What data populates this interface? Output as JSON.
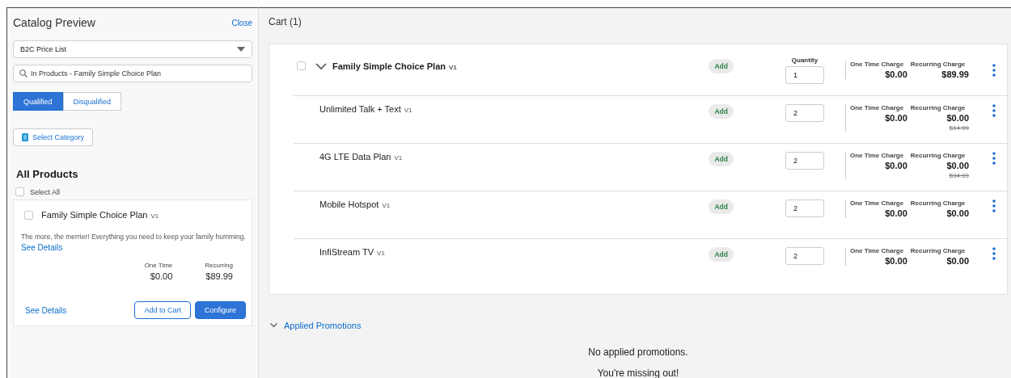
{
  "sidebar": {
    "title": "Catalog Preview",
    "close": "Close",
    "price_list": "B2C Price List",
    "search": {
      "value": "In Products - Family Simple Choice Plan"
    },
    "tabs": [
      {
        "label": "Qualified",
        "selected": true
      },
      {
        "label": "Disqualified",
        "selected": false
      }
    ],
    "category_button": "Select Category",
    "heading": "All Products",
    "select_all": {
      "label": "Select All",
      "checked": false
    },
    "products": [
      {
        "name": "Family Simple Choice Plan",
        "version": "V1",
        "checked": false,
        "description": "The more, the merrier! Everything you need to keep your family humming.",
        "details_link": "See Details",
        "one_time_label": "One Time",
        "one_time": "$0.00",
        "recurring_label": "Recurring",
        "recurring": "$89.99",
        "footer_link": "See Details",
        "buttons": [
          "Add to Cart",
          "Configure"
        ]
      }
    ]
  },
  "cart": {
    "title": "Cart (1)",
    "items": [
      {
        "kind": "parent",
        "name": "Family Simple Choice Plan",
        "version": "V1",
        "checked": false,
        "expanded": true,
        "badge": "Add",
        "quantity_label": "Quantity",
        "quantity": "1",
        "one_time_label": "One Time Charge",
        "recurring_label": "Recurring Charge",
        "one_time": "$0.00",
        "recurring": "$89.99"
      },
      {
        "kind": "child",
        "name": "Unlimited Talk + Text",
        "version": "V1",
        "badge": "Add",
        "quantity": "2",
        "one_time_label": "One Time Charge",
        "recurring_label": "Recurring Charge",
        "one_time": "$0.00",
        "recurring": "$0.00",
        "original": "$14.99"
      },
      {
        "kind": "child",
        "name": "4G LTE Data Plan",
        "version": "V1",
        "badge": "Add",
        "quantity": "2",
        "one_time_label": "One Time Charge",
        "recurring_label": "Recurring Charge",
        "one_time": "$0.00",
        "recurring": "$0.00",
        "original": "$34.99"
      },
      {
        "kind": "child",
        "name": "Mobile Hotspot",
        "version": "V1",
        "badge": "Add",
        "quantity": "2",
        "one_time_label": "One Time Charge",
        "recurring_label": "Recurring Charge",
        "one_time": "$0.00",
        "recurring": "$0.00"
      },
      {
        "kind": "child",
        "name": "InfiStream TV",
        "version": "V1",
        "badge": "Add",
        "quantity": "2",
        "one_time_label": "One Time Charge",
        "recurring_label": "Recurring Charge",
        "one_time": "$0.00",
        "recurring": "$0.00"
      }
    ]
  },
  "promotions": {
    "label": "Applied Promotions",
    "expanded": true,
    "messages": [
      "No applied promotions.",
      "You're missing out!"
    ]
  }
}
